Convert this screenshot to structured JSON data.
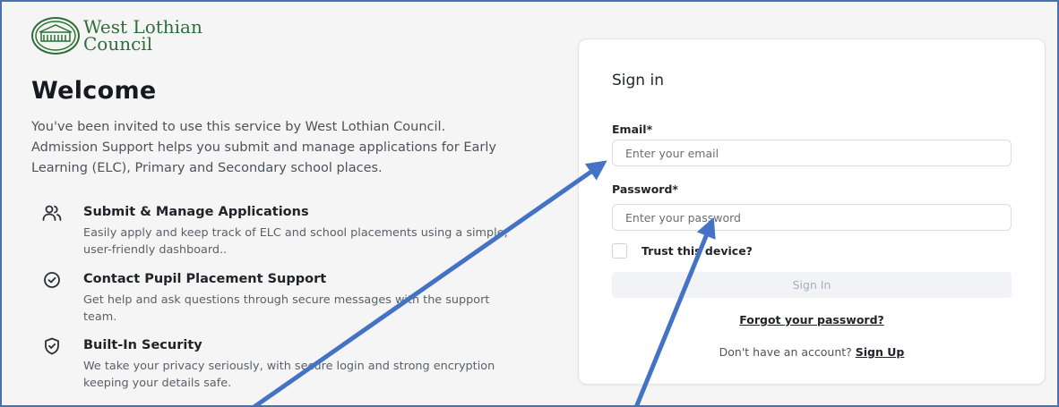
{
  "brand": {
    "line1": "West Lothian",
    "line2": "Council",
    "color": "#2d6e3a"
  },
  "left": {
    "title": "Welcome",
    "intro": "You've been invited to use this service by West Lothian Council. Admission Support helps you submit and manage applications for Early Learning (ELC), Primary and Secondary school places.",
    "features": [
      {
        "icon": "users-icon",
        "title": "Submit & Manage Applications",
        "description": "Easily apply and keep track of ELC and school placements using a simple, user-friendly dashboard.."
      },
      {
        "icon": "check-circle-icon",
        "title": "Contact Pupil Placement Support",
        "description": "Get help and ask questions through secure messages with the support team."
      },
      {
        "icon": "shield-check-icon",
        "title": "Built-In Security",
        "description": "We take your privacy seriously, with secure login and strong encryption keeping your details safe."
      }
    ]
  },
  "signin": {
    "title": "Sign in",
    "email_label": "Email*",
    "email_placeholder": "Enter your email",
    "email_value": "",
    "password_label": "Password*",
    "password_placeholder": "Enter your password",
    "password_value": "",
    "trust_label": "Trust this device?",
    "trust_checked": false,
    "button_label": "Sign In",
    "forgot_label": "Forgot your password?",
    "signup_prompt": "Don't have an account?",
    "signup_link": "Sign Up"
  },
  "colors": {
    "frame_border": "#4a6fb5",
    "annotation_arrow": "#4472c4",
    "brand_green": "#2d6e3a"
  }
}
